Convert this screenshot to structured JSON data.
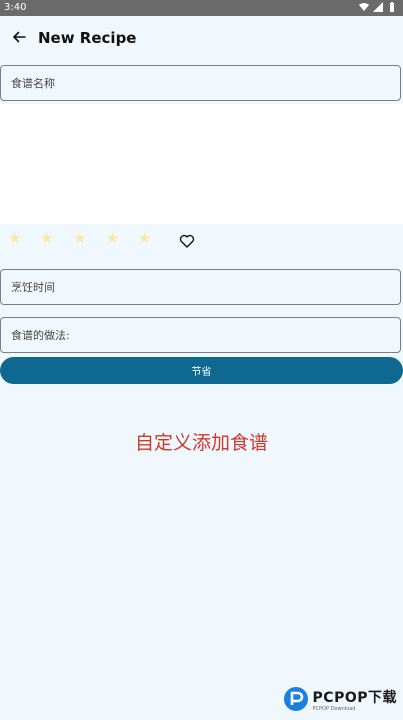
{
  "status_bar": {
    "time": "3:40"
  },
  "header": {
    "title": "New Recipe",
    "back_icon": "arrow-left-icon"
  },
  "form": {
    "name_placeholder": "食谱名称",
    "rating": {
      "max": 5,
      "value": 0,
      "star_color": "#f7e7a8"
    },
    "favorite_icon": "heart-outline-icon",
    "cook_time_placeholder": "烹饪时间",
    "method_placeholder": "食谱的做法:",
    "save_label": "节省"
  },
  "caption": "自定义添加食谱",
  "watermark": {
    "brand": "PCPOP下载",
    "sub": "PCPOP Download"
  },
  "colors": {
    "background": "#f1f8fd",
    "accent": "#0e6890",
    "caption": "#d0382c"
  }
}
